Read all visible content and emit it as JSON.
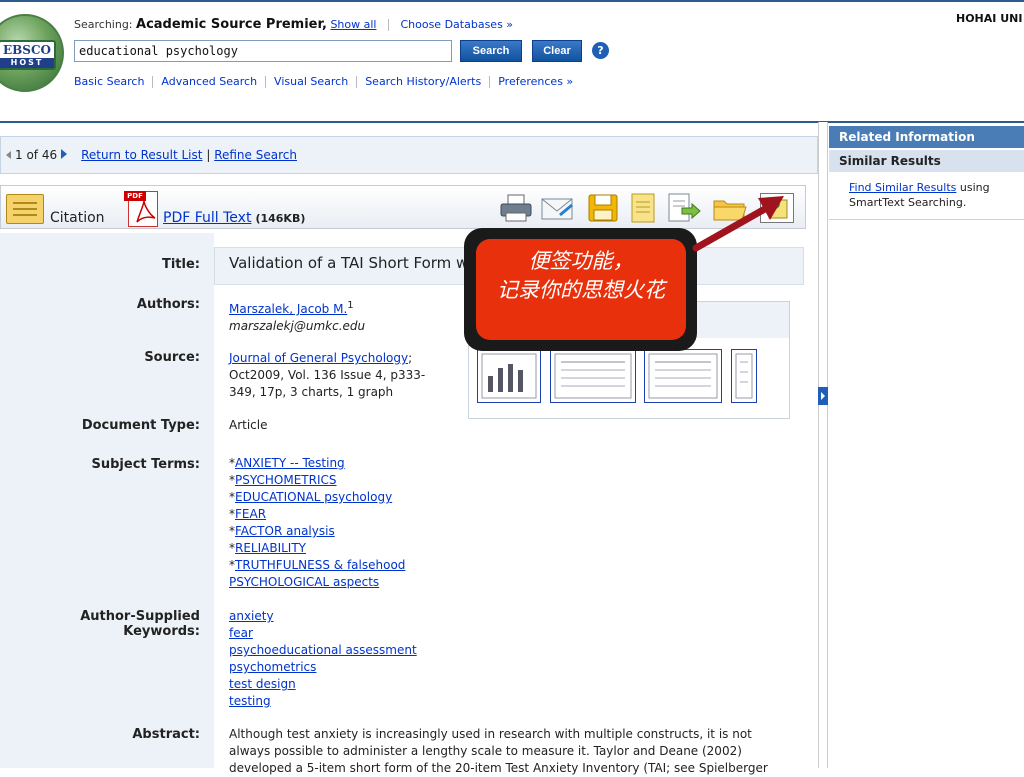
{
  "header": {
    "logo_top": "EBSCO",
    "logo_bottom": "HOST",
    "searching_prefix": "Searching:",
    "searching_db": "Academic Source Premier,",
    "show_all": "Show all",
    "choose_databases": "Choose Databases »",
    "query": "educational psychology",
    "search_label": "Search",
    "clear_label": "Clear",
    "help_label": "?",
    "institution": "HOHAI UNI",
    "nav": [
      "Basic Search",
      "Advanced Search",
      "Visual Search",
      "Search History/Alerts",
      "Preferences »"
    ]
  },
  "result_nav": {
    "position": "1 of 46",
    "return_label": "Return to Result List",
    "divider": "|",
    "refine_label": "Refine Search"
  },
  "toolbar": {
    "citation_label": "Citation",
    "pdf_tag": "PDF",
    "pdf_label": "PDF Full Text",
    "pdf_size": "(146KB)",
    "tools": [
      "print-icon",
      "email-icon",
      "save-icon",
      "cite-icon",
      "export-icon",
      "folder-icon",
      "add-note-icon"
    ]
  },
  "record": {
    "title_label": "Title:",
    "title": "Validation of a TAI Short Form w",
    "authors_label": "Authors:",
    "author_name": "Marszalek, Jacob M.",
    "author_sup": "1",
    "author_email": "marszalekj@umkc.edu",
    "source_label": "Source:",
    "source_journal": "Journal of General Psychology",
    "source_sep": ";",
    "source_detail_1": "Oct2009, Vol. 136 Issue 4, p333-",
    "source_detail_2": "349, 17p, 3 charts, 1 graph",
    "doctype_label": "Document Type:",
    "doctype": "Article",
    "subject_label": "Subject Terms:",
    "subjects": [
      {
        "prefix": "*",
        "term": "ANXIETY -- Testing"
      },
      {
        "prefix": "*",
        "term": "PSYCHOMETRICS"
      },
      {
        "prefix": "*",
        "term": "EDUCATIONAL psychology"
      },
      {
        "prefix": "*",
        "term": "FEAR"
      },
      {
        "prefix": "*",
        "term": "FACTOR analysis"
      },
      {
        "prefix": "*",
        "term": "RELIABILITY"
      },
      {
        "prefix": "*",
        "term": "TRUTHFULNESS & falsehood"
      },
      {
        "prefix": "",
        "term": "PSYCHOLOGICAL aspects"
      }
    ],
    "keywords_label": "Author-Supplied Keywords:",
    "keywords": [
      "anxiety",
      "fear",
      "psychoeducational assessment",
      "psychometrics",
      "test design",
      "testing"
    ],
    "abstract_label": "Abstract:",
    "abstract_1": "Although test anxiety is increasingly used in research with multiple constructs, it is not",
    "abstract_2": "always possible to administer a lengthy scale to measure it. Taylor and Deane (2002)",
    "abstract_3": "developed a 5-item short form of the 20-item Test Anxiety Inventory (TAI; see Spielberger"
  },
  "callout": {
    "line1": "便签功能，",
    "line2": "记录你的思想火花"
  },
  "right_panel": {
    "related_title": "Related Information",
    "similar_title": "Similar Results",
    "find_similar": "Find Similar Results",
    "find_similar_suffix": " using",
    "smarttext": "SmartText Searching."
  },
  "colors": {
    "brand_blue": "#2d5b8c",
    "link": "#0033cc",
    "callout": "#e8300d",
    "arrow": "#a0141e"
  }
}
